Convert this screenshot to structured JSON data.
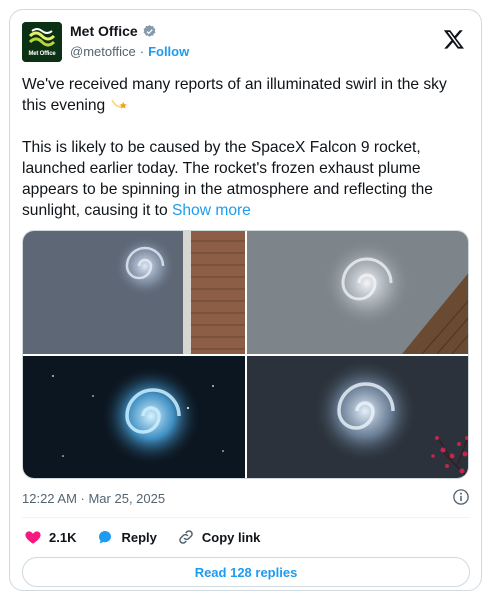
{
  "author": {
    "display_name": "Met Office",
    "handle": "@metoffice",
    "separator": "·",
    "follow_label": "Follow",
    "avatar_text": "Met Office",
    "verified": true
  },
  "tweet": {
    "paragraph1": "We've received many reports of an illuminated swirl in the sky this evening",
    "paragraph1_emoji": "shooting-star-icon",
    "paragraph2": "This is likely to be caused by the SpaceX Falcon 9 rocket, launched earlier today. The rocket's frozen exhaust plume appears to be spinning in the atmosphere and reflecting the sunlight, causing it to",
    "show_more": "Show more"
  },
  "media": {
    "photo_count": 4,
    "photos": [
      "photo-swirl-brick-wall",
      "photo-swirl-rooftop",
      "photo-swirl-dark-sky",
      "photo-swirl-tree"
    ]
  },
  "meta": {
    "timestamp": "12:22 AM · Mar 25, 2025"
  },
  "actions": {
    "like_count": "2.1K",
    "reply_label": "Reply",
    "copy_link_label": "Copy link"
  },
  "read_replies_label": "Read 128 replies",
  "colors": {
    "accent": "#1d9bf0",
    "like": "#f91880",
    "text": "#0f1419",
    "secondary": "#536471",
    "border": "#cfd9de"
  }
}
